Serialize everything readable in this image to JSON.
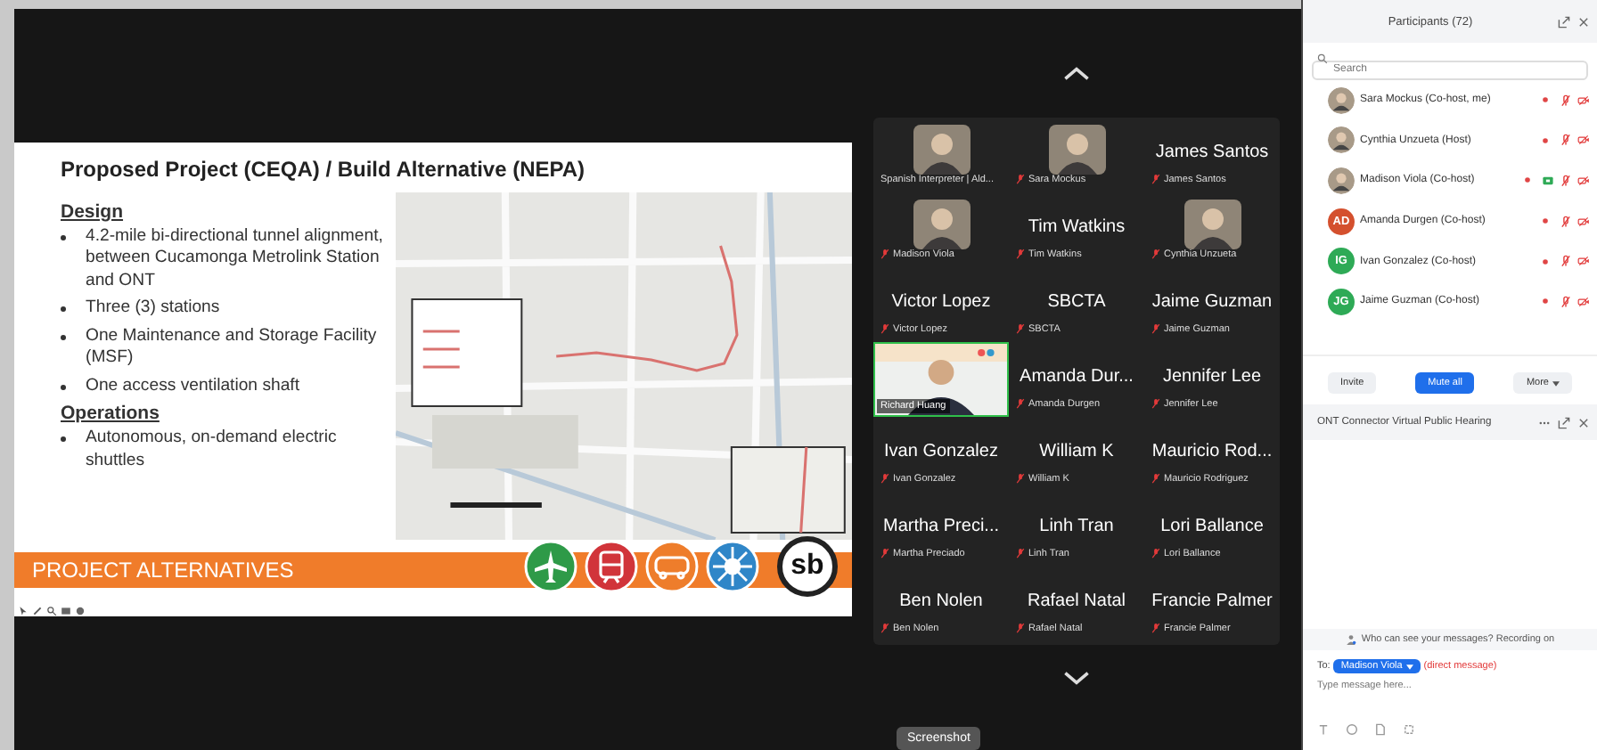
{
  "slide": {
    "title": "Proposed Project (CEQA) / Build Alternative (NEPA)",
    "sections": [
      {
        "heading": "Design",
        "bullets": [
          "4.2-mile bi-directional tunnel alignment, between Cucamonga Metrolink Station and ONT",
          "Three (3) stations",
          "One Maintenance and Storage Facility (MSF)",
          "One access ventilation shaft"
        ]
      },
      {
        "heading": "Operations",
        "bullets": [
          "Autonomous, on-demand electric shuttles"
        ]
      }
    ],
    "banner": "PROJECT ALTERNATIVES",
    "logos": [
      {
        "kind": "plane",
        "color": "#2e9a48"
      },
      {
        "kind": "train",
        "color": "#d1343a"
      },
      {
        "kind": "bus",
        "color": "#ee7d2b"
      },
      {
        "kind": "wheel",
        "color": "#2f86c8"
      }
    ],
    "logo_text": "sb"
  },
  "video_grid": {
    "tiles": [
      {
        "kind": "avatar",
        "label": "Spanish Interpreter | Ald...",
        "muted": false,
        "speaking": false
      },
      {
        "kind": "avatar",
        "label": "Sara Mockus",
        "muted": true,
        "speaking": false
      },
      {
        "kind": "name",
        "name": "James Santos",
        "label": "James Santos",
        "muted": true,
        "speaking": false
      },
      {
        "kind": "avatar",
        "label": "Madison Viola",
        "muted": true,
        "speaking": false
      },
      {
        "kind": "name",
        "name": "Tim Watkins",
        "label": "Tim Watkins",
        "muted": true,
        "speaking": false
      },
      {
        "kind": "avatar",
        "label": "Cynthia Unzueta",
        "muted": true,
        "speaking": false
      },
      {
        "kind": "name",
        "name": "Victor Lopez",
        "label": "Victor Lopez",
        "muted": true,
        "speaking": false
      },
      {
        "kind": "name",
        "name": "SBCTA",
        "label": "SBCTA",
        "muted": true,
        "speaking": false
      },
      {
        "kind": "name",
        "name": "Jaime Guzman",
        "label": "Jaime Guzman",
        "muted": true,
        "speaking": false
      },
      {
        "kind": "video",
        "label": "Richard Huang",
        "muted": false,
        "speaking": true
      },
      {
        "kind": "name",
        "name": "Amanda Dur...",
        "label": "Amanda Durgen",
        "muted": true,
        "speaking": false
      },
      {
        "kind": "name",
        "name": "Jennifer Lee",
        "label": "Jennifer Lee",
        "muted": true,
        "speaking": false
      },
      {
        "kind": "name",
        "name": "Ivan Gonzalez",
        "label": "Ivan Gonzalez",
        "muted": true,
        "speaking": false
      },
      {
        "kind": "name",
        "name": "William K",
        "label": "William K",
        "muted": true,
        "speaking": false
      },
      {
        "kind": "name",
        "name": "Mauricio Rod...",
        "label": "Mauricio Rodriguez",
        "muted": true,
        "speaking": false
      },
      {
        "kind": "name",
        "name": "Martha Preci...",
        "label": "Martha Preciado",
        "muted": true,
        "speaking": false
      },
      {
        "kind": "name",
        "name": "Linh Tran",
        "label": "Linh Tran",
        "muted": true,
        "speaking": false
      },
      {
        "kind": "name",
        "name": "Lori Ballance",
        "label": "Lori Ballance",
        "muted": true,
        "speaking": false
      },
      {
        "kind": "name",
        "name": "Ben Nolen",
        "label": "Ben Nolen",
        "muted": true,
        "speaking": false
      },
      {
        "kind": "name",
        "name": "Rafael Natal",
        "label": "Rafael Natal",
        "muted": true,
        "speaking": false
      },
      {
        "kind": "name",
        "name": "Francie Palmer",
        "label": "Francie Palmer",
        "muted": true,
        "speaking": false
      }
    ]
  },
  "tooltip": "Screenshot",
  "participants": {
    "title": "Participants (72)",
    "search": {
      "placeholder": "Search"
    },
    "items": [
      {
        "name": "Sara Mockus (Co-host, me)",
        "muted": true,
        "video_off": true,
        "sharing": false
      },
      {
        "name": "Cynthia Unzueta (Host)",
        "muted": true,
        "video_off": true,
        "sharing": false
      },
      {
        "name": "Madison Viola (Co-host)",
        "muted": true,
        "video_off": true,
        "sharing": true
      },
      {
        "name": "Amanda Durgen (Co-host)",
        "kind": "initials",
        "initials": "AD",
        "color": "#d4502e",
        "muted": true,
        "video_off": true,
        "sharing": false
      },
      {
        "name": "Ivan Gonzalez (Co-host)",
        "kind": "initials",
        "initials": "IG",
        "color": "#2eaa56",
        "muted": true,
        "video_off": true,
        "sharing": false
      },
      {
        "name": "Jaime Guzman (Co-host)",
        "kind": "initials",
        "initials": "JG",
        "color": "#2eaa56",
        "muted": true,
        "video_off": true,
        "sharing": false
      }
    ],
    "buttons": [
      {
        "label": "Invite",
        "primary": false,
        "dropdown": false
      },
      {
        "label": "Mute all",
        "primary": true,
        "dropdown": false
      },
      {
        "label": "More",
        "primary": false,
        "dropdown": true
      }
    ]
  },
  "chat": {
    "title": "ONT Connector Virtual Public Hearing",
    "notice": "Who can see your messages? Recording on",
    "to_label": "To:",
    "recipient": "Madison Viola",
    "recipient_note": "(direct message)",
    "input": {
      "placeholder": "Type message here..."
    }
  }
}
